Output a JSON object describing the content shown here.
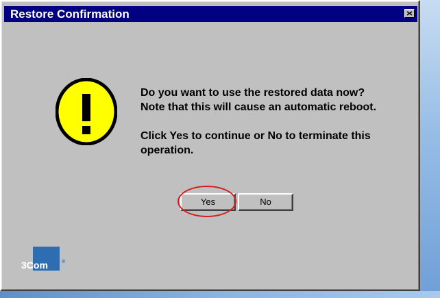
{
  "window": {
    "title": "Restore Confirmation",
    "close_icon": "close-icon"
  },
  "message": {
    "line1": "Do you want to use the restored data now?",
    "line2": "Note that this will cause an automatic reboot.",
    "line3": "Click Yes to continue or No to terminate this operation."
  },
  "buttons": {
    "yes": "Yes",
    "no": "No"
  },
  "icons": {
    "warning": "warning-icon",
    "logo": "logo-3com"
  },
  "branding": {
    "logo_text": "3Com",
    "logo_mark": "®"
  },
  "colors": {
    "titlebar": "#000080",
    "dialog_face": "#c0c0c0",
    "warning_fill": "#ffff00",
    "highlight": "#d41e1e",
    "logo_blue": "#2f6db3"
  }
}
